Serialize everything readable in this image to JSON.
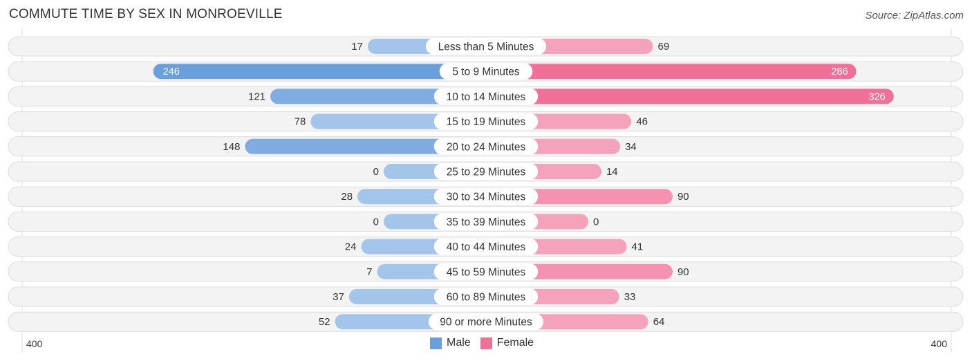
{
  "header": {
    "title": "COMMUTE TIME BY SEX IN MONROEVILLE",
    "source": "Source: ZipAtlas.com"
  },
  "colors": {
    "male": "#6a9fdc",
    "male_light": "#a4c5ea",
    "female": "#f07098",
    "female_light": "#f5a3bd"
  },
  "chart_data": {
    "type": "bar",
    "orientation": "horizontal-diverging",
    "title": "COMMUTE TIME BY SEX IN MONROEVILLE",
    "categories": [
      "Less than 5 Minutes",
      "5 to 9 Minutes",
      "10 to 14 Minutes",
      "15 to 19 Minutes",
      "20 to 24 Minutes",
      "25 to 29 Minutes",
      "30 to 34 Minutes",
      "35 to 39 Minutes",
      "40 to 44 Minutes",
      "45 to 59 Minutes",
      "60 to 89 Minutes",
      "90 or more Minutes"
    ],
    "series": [
      {
        "name": "Male",
        "values": [
          17,
          246,
          121,
          78,
          148,
          0,
          28,
          0,
          24,
          7,
          37,
          52
        ]
      },
      {
        "name": "Female",
        "values": [
          69,
          286,
          326,
          46,
          34,
          14,
          90,
          0,
          41,
          90,
          33,
          64
        ]
      }
    ],
    "axis": {
      "left_label": "400",
      "right_label": "400",
      "range": [
        400,
        400
      ]
    },
    "legend": {
      "position": "bottom-center",
      "entries": [
        "Male",
        "Female"
      ]
    }
  }
}
